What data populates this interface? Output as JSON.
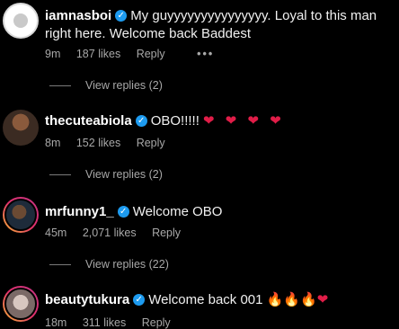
{
  "comments": [
    {
      "user": "iamnasboi",
      "text": "My guyyyyyyyyyyyyyyy. Loyal to this man right here. Welcome back Baddest",
      "time": "9m",
      "likes": "187 likes",
      "reply": "Reply",
      "more": "•••",
      "view_replies": "View replies (2)"
    },
    {
      "user": "thecuteabiola",
      "text": "OBO!!!!!",
      "emoji": "❤ ❤ ❤ ❤",
      "time": "8m",
      "likes": "152 likes",
      "reply": "Reply",
      "view_replies": "View replies (2)"
    },
    {
      "user": "mrfunny1_",
      "text": "Welcome OBO",
      "time": "45m",
      "likes": "2,071 likes",
      "reply": "Reply",
      "view_replies": "View replies (22)"
    },
    {
      "user": "beautytukura",
      "text": "Welcome back 001",
      "emoji": "🔥🔥🔥❤",
      "time": "18m",
      "likes": "311 likes",
      "reply": "Reply"
    }
  ],
  "colors": {
    "verified": "#1d9bf0",
    "heart": "#e11d48",
    "muted": "#a8a8a8"
  }
}
